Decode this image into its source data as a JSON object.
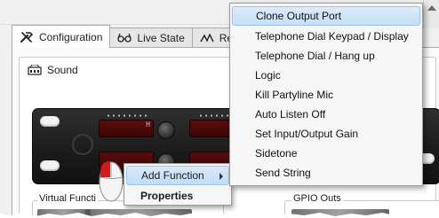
{
  "tabs": [
    {
      "label": "Configuration",
      "icon": "tools-icon"
    },
    {
      "label": "Live State",
      "icon": "glasses-icon"
    },
    {
      "label": "Remo",
      "icon": "signal-icon"
    }
  ],
  "group": {
    "label": "Sound",
    "icon": "device-icon"
  },
  "device": {
    "display_char": "H"
  },
  "bottom": {
    "left_label": "Virtual Functi",
    "right_label": "GPIO Outs"
  },
  "context_menu": {
    "items": [
      {
        "label": "Add Function",
        "has_submenu": true,
        "highlighted": true
      },
      {
        "label": "Properties",
        "bold": true
      }
    ]
  },
  "submenu": {
    "items": [
      {
        "label": "Clone Output Port",
        "highlighted": true
      },
      {
        "label": "Telephone Dial Keypad / Display"
      },
      {
        "label": "Telephone Dial / Hang up"
      },
      {
        "label": "Logic"
      },
      {
        "label": "Kill Partyline Mic"
      },
      {
        "label": "Auto Listen Off"
      },
      {
        "label": "Set Input/Output Gain"
      },
      {
        "label": "Sidetone"
      },
      {
        "label": "Send String"
      }
    ]
  },
  "colors": {
    "highlight": "#c5def6",
    "display_red": "#5a0d0d",
    "mouse_button": "#d21b1b"
  }
}
